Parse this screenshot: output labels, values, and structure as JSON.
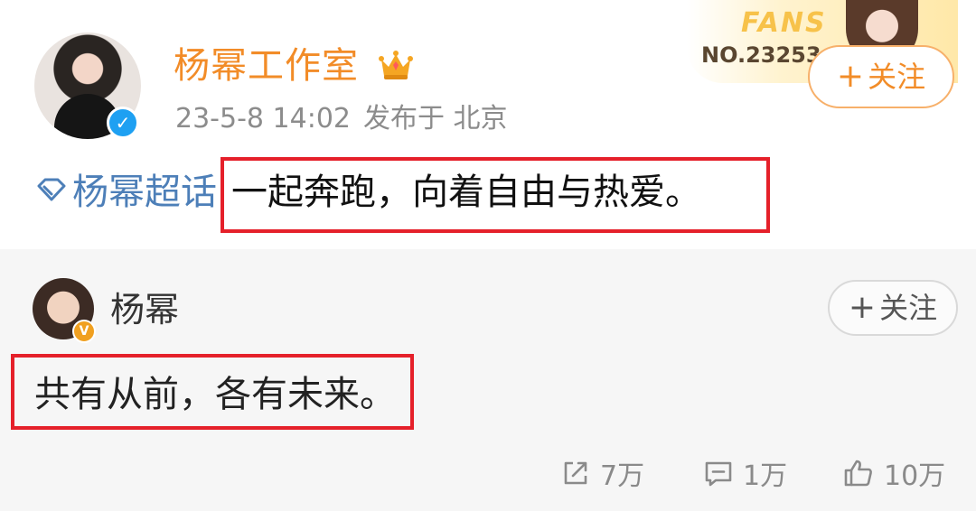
{
  "post": {
    "author": "杨幂工作室",
    "time": "23-5-8 14:02",
    "location": "发布于 北京",
    "topic": "杨幂超话",
    "text": "一起奔跑，向着自由与热爱。",
    "follow_label": "关注",
    "fans_card": {
      "title": "FANS",
      "number": "NO.23253"
    }
  },
  "repost": {
    "author": "杨幂",
    "follow_label": "关注",
    "text": "共有从前，各有未来。",
    "actions": {
      "share": "7万",
      "comment": "1万",
      "like": "10万"
    }
  },
  "colors": {
    "accent_orange": "#f28c28",
    "topic_blue": "#4d7fb8",
    "highlight_red": "#e5202a",
    "verify_blue": "#1ea0f2"
  },
  "icons": [
    "crown-icon",
    "verified-icon",
    "topic-diamond-icon",
    "share-icon",
    "comment-icon",
    "like-icon",
    "plus-icon"
  ]
}
